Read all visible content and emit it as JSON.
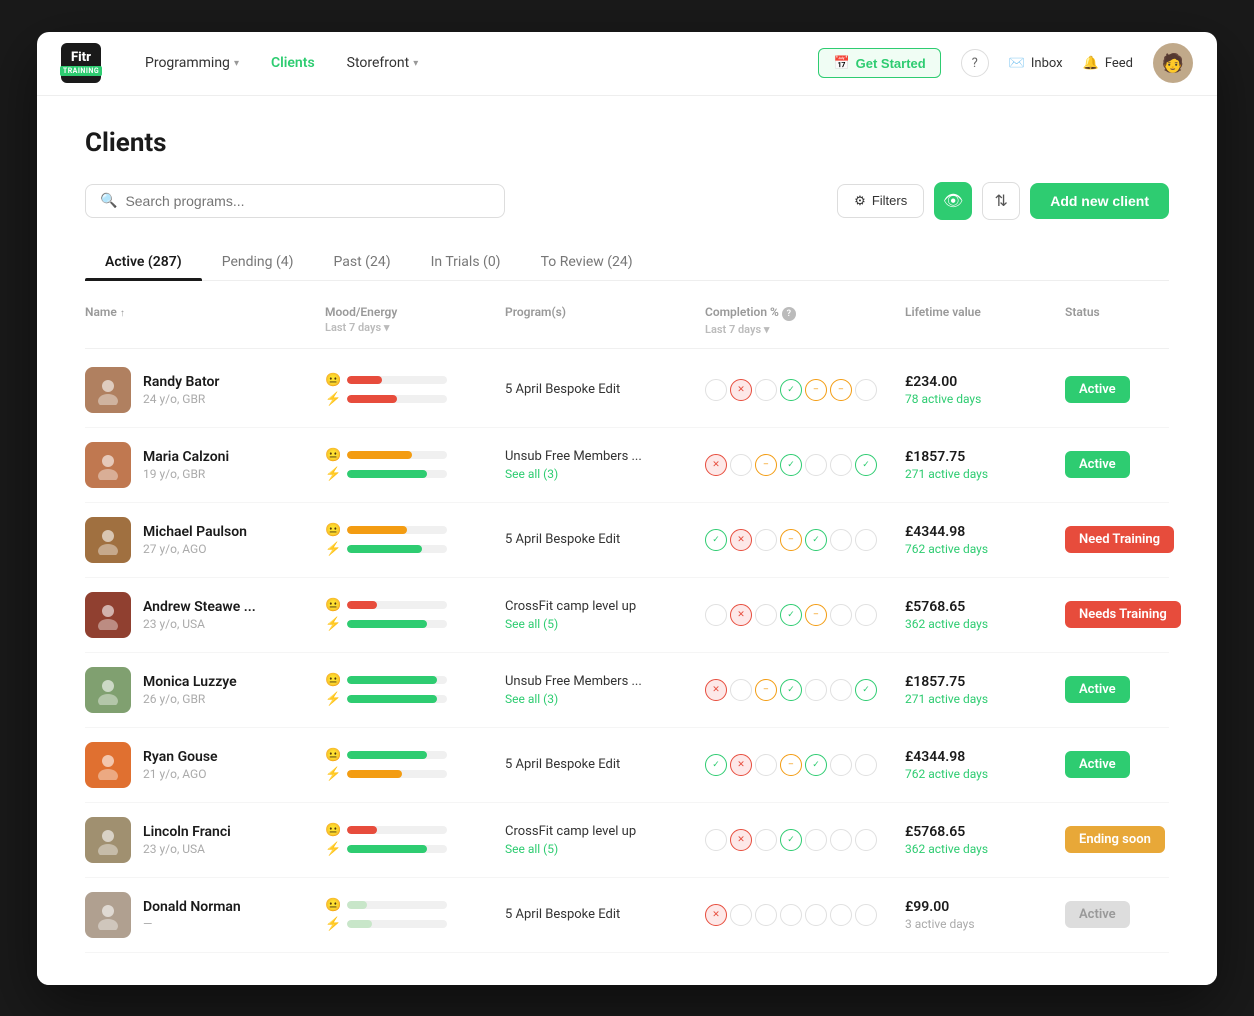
{
  "app": {
    "logo": {
      "fitr": "Fitr",
      "training": "TRAINING"
    },
    "nav": {
      "items": [
        {
          "label": "Programming",
          "hasDropdown": true,
          "active": false
        },
        {
          "label": "Clients",
          "hasDropdown": false,
          "active": true
        },
        {
          "label": "Storefront",
          "hasDropdown": true,
          "active": false
        }
      ],
      "right": {
        "get_started": "Get Started",
        "help_icon": "?",
        "inbox": "Inbox",
        "feed": "Feed"
      }
    }
  },
  "page": {
    "title": "Clients",
    "search_placeholder": "Search programs...",
    "filter_label": "Filters",
    "add_client_label": "Add new client"
  },
  "tabs": [
    {
      "label": "Active (287)",
      "active": true
    },
    {
      "label": "Pending (4)",
      "active": false
    },
    {
      "label": "Past (24)",
      "active": false
    },
    {
      "label": "In Trials (0)",
      "active": false
    },
    {
      "label": "To Review (24)",
      "active": false
    }
  ],
  "table": {
    "columns": [
      {
        "label": "Name",
        "sort": true,
        "sub": ""
      },
      {
        "label": "Mood/Energy",
        "sort": false,
        "sub": "Last 7 days ▾"
      },
      {
        "label": "Program(s)",
        "sort": false,
        "sub": ""
      },
      {
        "label": "Completion %",
        "sort": false,
        "sub": "Last 7 days ▾",
        "info": true
      },
      {
        "label": "Lifetime value",
        "sort": false,
        "sub": ""
      },
      {
        "label": "Status",
        "sort": false,
        "sub": ""
      }
    ],
    "rows": [
      {
        "name": "Randy Bator",
        "sub": "24 y/o, GBR",
        "avatar_emoji": "👤",
        "avatar_color": "#b08060",
        "mood_top_pct": 35,
        "mood_top_color": "#e74c3c",
        "energy_top_pct": 50,
        "energy_top_color": "#e74c3c",
        "mood_bot_pct": 0,
        "mood_bot_color": "#2ecc71",
        "energy_bot_pct": 0,
        "energy_bot_color": "#2ecc71",
        "program": "5 April Bespoke Edit",
        "see_all": "",
        "completion": [
          "empty",
          "cross",
          "empty",
          "check",
          "dash",
          "dash",
          "empty"
        ],
        "lifetime": "£234.00",
        "days": "78 active days",
        "days_dim": false,
        "status": "Active",
        "status_type": "active"
      },
      {
        "name": "Maria Calzoni",
        "sub": "19 y/o, GBR",
        "avatar_emoji": "👩",
        "avatar_color": "#c07850",
        "mood_top_pct": 65,
        "mood_top_color": "#f39c12",
        "energy_top_pct": 80,
        "energy_top_color": "#2ecc71",
        "mood_bot_pct": 0,
        "mood_bot_color": "#2ecc71",
        "energy_bot_pct": 0,
        "energy_bot_color": "#2ecc71",
        "program": "Unsub Free Members ...",
        "see_all": "See all (3)",
        "completion": [
          "cross",
          "empty",
          "dash",
          "check",
          "empty",
          "empty",
          "check"
        ],
        "lifetime": "£1857.75",
        "days": "271 active days",
        "days_dim": false,
        "status": "Active",
        "status_type": "active"
      },
      {
        "name": "Michael Paulson",
        "sub": "27 y/o, AGO",
        "avatar_emoji": "👨",
        "avatar_color": "#a07040",
        "mood_top_pct": 60,
        "mood_top_color": "#f39c12",
        "energy_top_pct": 75,
        "energy_top_color": "#2ecc71",
        "mood_bot_pct": 0,
        "mood_bot_color": "#2ecc71",
        "energy_bot_pct": 0,
        "energy_bot_color": "#2ecc71",
        "program": "5 April Bespoke Edit",
        "see_all": "",
        "completion": [
          "check",
          "cross",
          "empty",
          "dash",
          "check",
          "empty",
          "empty"
        ],
        "lifetime": "£4344.98",
        "days": "762 active days",
        "days_dim": false,
        "status": "Need Training",
        "status_type": "needs-training"
      },
      {
        "name": "Andrew Steawe ...",
        "sub": "23 y/o, USA",
        "avatar_emoji": "👤",
        "avatar_color": "#904030",
        "mood_top_pct": 30,
        "mood_top_color": "#e74c3c",
        "energy_top_pct": 80,
        "energy_top_color": "#2ecc71",
        "mood_bot_pct": 0,
        "mood_bot_color": "#2ecc71",
        "energy_bot_pct": 0,
        "energy_bot_color": "#2ecc71",
        "program": "CrossFit camp level up",
        "see_all": "See all (5)",
        "completion": [
          "empty",
          "cross",
          "empty",
          "check",
          "dash",
          "empty",
          "empty"
        ],
        "lifetime": "£5768.65",
        "days": "362 active days",
        "days_dim": false,
        "status": "Needs Training",
        "status_type": "needs-training"
      },
      {
        "name": "Monica Luzzye",
        "sub": "26 y/o, GBR",
        "avatar_emoji": "👩",
        "avatar_color": "#80a070",
        "mood_top_pct": 90,
        "mood_top_color": "#2ecc71",
        "energy_top_pct": 90,
        "energy_top_color": "#2ecc71",
        "mood_bot_pct": 0,
        "mood_bot_color": "#2ecc71",
        "energy_bot_pct": 0,
        "energy_bot_color": "#2ecc71",
        "program": "Unsub Free Members ...",
        "see_all": "See all (3)",
        "completion": [
          "cross",
          "empty",
          "dash",
          "check",
          "empty",
          "empty",
          "check"
        ],
        "lifetime": "£1857.75",
        "days": "271 active days",
        "days_dim": false,
        "status": "Active",
        "status_type": "active"
      },
      {
        "name": "Ryan Gouse",
        "sub": "21 y/o, AGO",
        "avatar_emoji": "👨",
        "avatar_color": "#e07030",
        "mood_top_pct": 80,
        "mood_top_color": "#2ecc71",
        "energy_top_pct": 55,
        "energy_top_color": "#f39c12",
        "mood_bot_pct": 0,
        "mood_bot_color": "#2ecc71",
        "energy_bot_pct": 0,
        "energy_bot_color": "#2ecc71",
        "program": "5 April Bespoke Edit",
        "see_all": "",
        "completion": [
          "check",
          "cross",
          "empty",
          "dash",
          "check",
          "empty",
          "empty"
        ],
        "lifetime": "£4344.98",
        "days": "762 active days",
        "days_dim": false,
        "status": "Active",
        "status_type": "active"
      },
      {
        "name": "Lincoln Franci",
        "sub": "23 y/o, USA",
        "avatar_emoji": "👤",
        "avatar_color": "#a09070",
        "mood_top_pct": 30,
        "mood_top_color": "#e74c3c",
        "energy_top_pct": 80,
        "energy_top_color": "#2ecc71",
        "mood_bot_pct": 0,
        "mood_bot_color": "#2ecc71",
        "energy_bot_pct": 0,
        "energy_bot_color": "#2ecc71",
        "program": "CrossFit camp level up",
        "see_all": "See all (5)",
        "completion": [
          "empty",
          "cross",
          "empty",
          "check",
          "empty",
          "empty",
          "empty"
        ],
        "lifetime": "£5768.65",
        "days": "362 active days",
        "days_dim": false,
        "status": "Ending soon",
        "status_type": "ending-soon"
      },
      {
        "name": "Donald Norman",
        "sub": "—",
        "avatar_emoji": "👤",
        "avatar_color": "#b0a090",
        "mood_top_pct": 20,
        "mood_top_color": "#c8e6c9",
        "energy_top_pct": 25,
        "energy_top_color": "#c8e6c9",
        "mood_bot_pct": 0,
        "mood_bot_color": "#e0e0e0",
        "energy_bot_pct": 0,
        "energy_bot_color": "#e0e0e0",
        "program": "5 April Bespoke Edit",
        "see_all": "",
        "completion": [
          "cross",
          "empty",
          "empty",
          "empty",
          "empty",
          "empty",
          "empty"
        ],
        "lifetime": "£99.00",
        "days": "3 active days",
        "days_dim": true,
        "status": "Active",
        "status_type": "active-disabled"
      }
    ]
  }
}
